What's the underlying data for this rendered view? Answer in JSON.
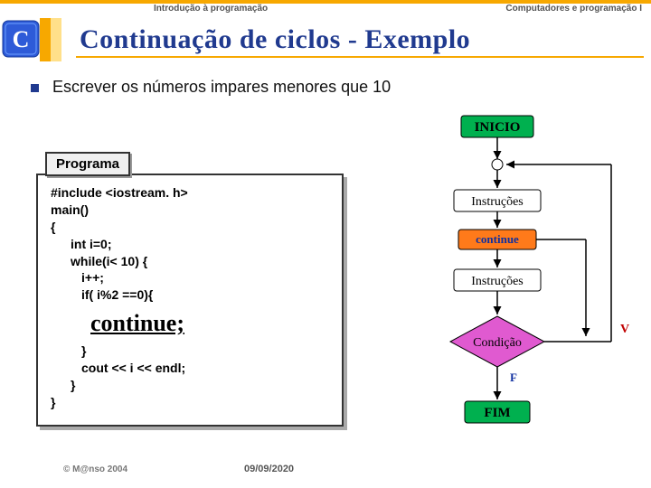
{
  "header": {
    "left": "Introdução à programação",
    "right": "Computadores e programação I"
  },
  "title": "Continuação de ciclos - Exemplo",
  "body": "Escrever os números impares menores que 10",
  "program_label": "Programa",
  "code": {
    "l1": "#include <iostream. h>",
    "l2": "main()",
    "l3": "{",
    "l4": "int i=0;",
    "l5": "while(i< 10) {",
    "l6": "i++;",
    "l7": "if( i%2 ==0){",
    "cont": "continue;",
    "l8": "}",
    "l9": "cout << i << endl;",
    "l10": "}",
    "l11": "}"
  },
  "flow": {
    "start": "INICIO",
    "instr": "Instruções",
    "cont": "continue",
    "cond": "Condição",
    "v": "V",
    "f": "F",
    "end": "FIM"
  },
  "footer": {
    "copyright": "© M@nso 2004",
    "date": "09/09/2020"
  }
}
